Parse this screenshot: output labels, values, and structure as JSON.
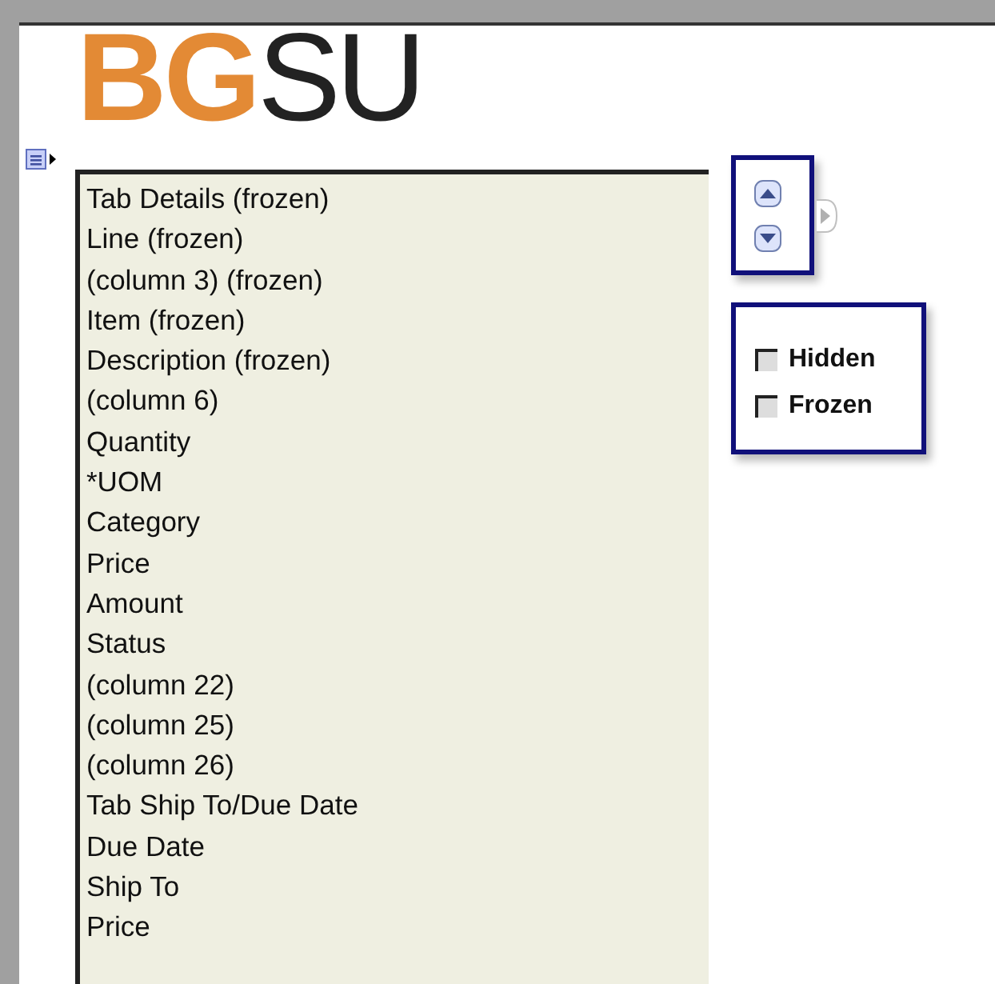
{
  "logo": "**BG**SU",
  "columns": [
    {
      "label": "Tab Details (frozen)"
    },
    {
      "label": "Line (frozen)"
    },
    {
      "label": "(column 3) (frozen)"
    },
    {
      "label": "Item (frozen)"
    },
    {
      "label": "Description (frozen)"
    },
    {
      "label": "(column 6)"
    },
    {
      "label": "Quantity"
    },
    {
      "label": "*UOM"
    },
    {
      "label": "Category"
    },
    {
      "label": "Price"
    },
    {
      "label": "Amount"
    },
    {
      "label": "Status"
    },
    {
      "label": "(column 22)"
    },
    {
      "label": "(column 25)"
    },
    {
      "label": "(column 26)"
    },
    {
      "label": "Tab Ship To/Due Date"
    },
    {
      "label": "Due Date"
    },
    {
      "label": "Ship To"
    },
    {
      "label": "Price"
    }
  ],
  "options": [
    {
      "label": "Hidden",
      "checked": false
    },
    {
      "label": "Frozen",
      "checked": false
    }
  ]
}
